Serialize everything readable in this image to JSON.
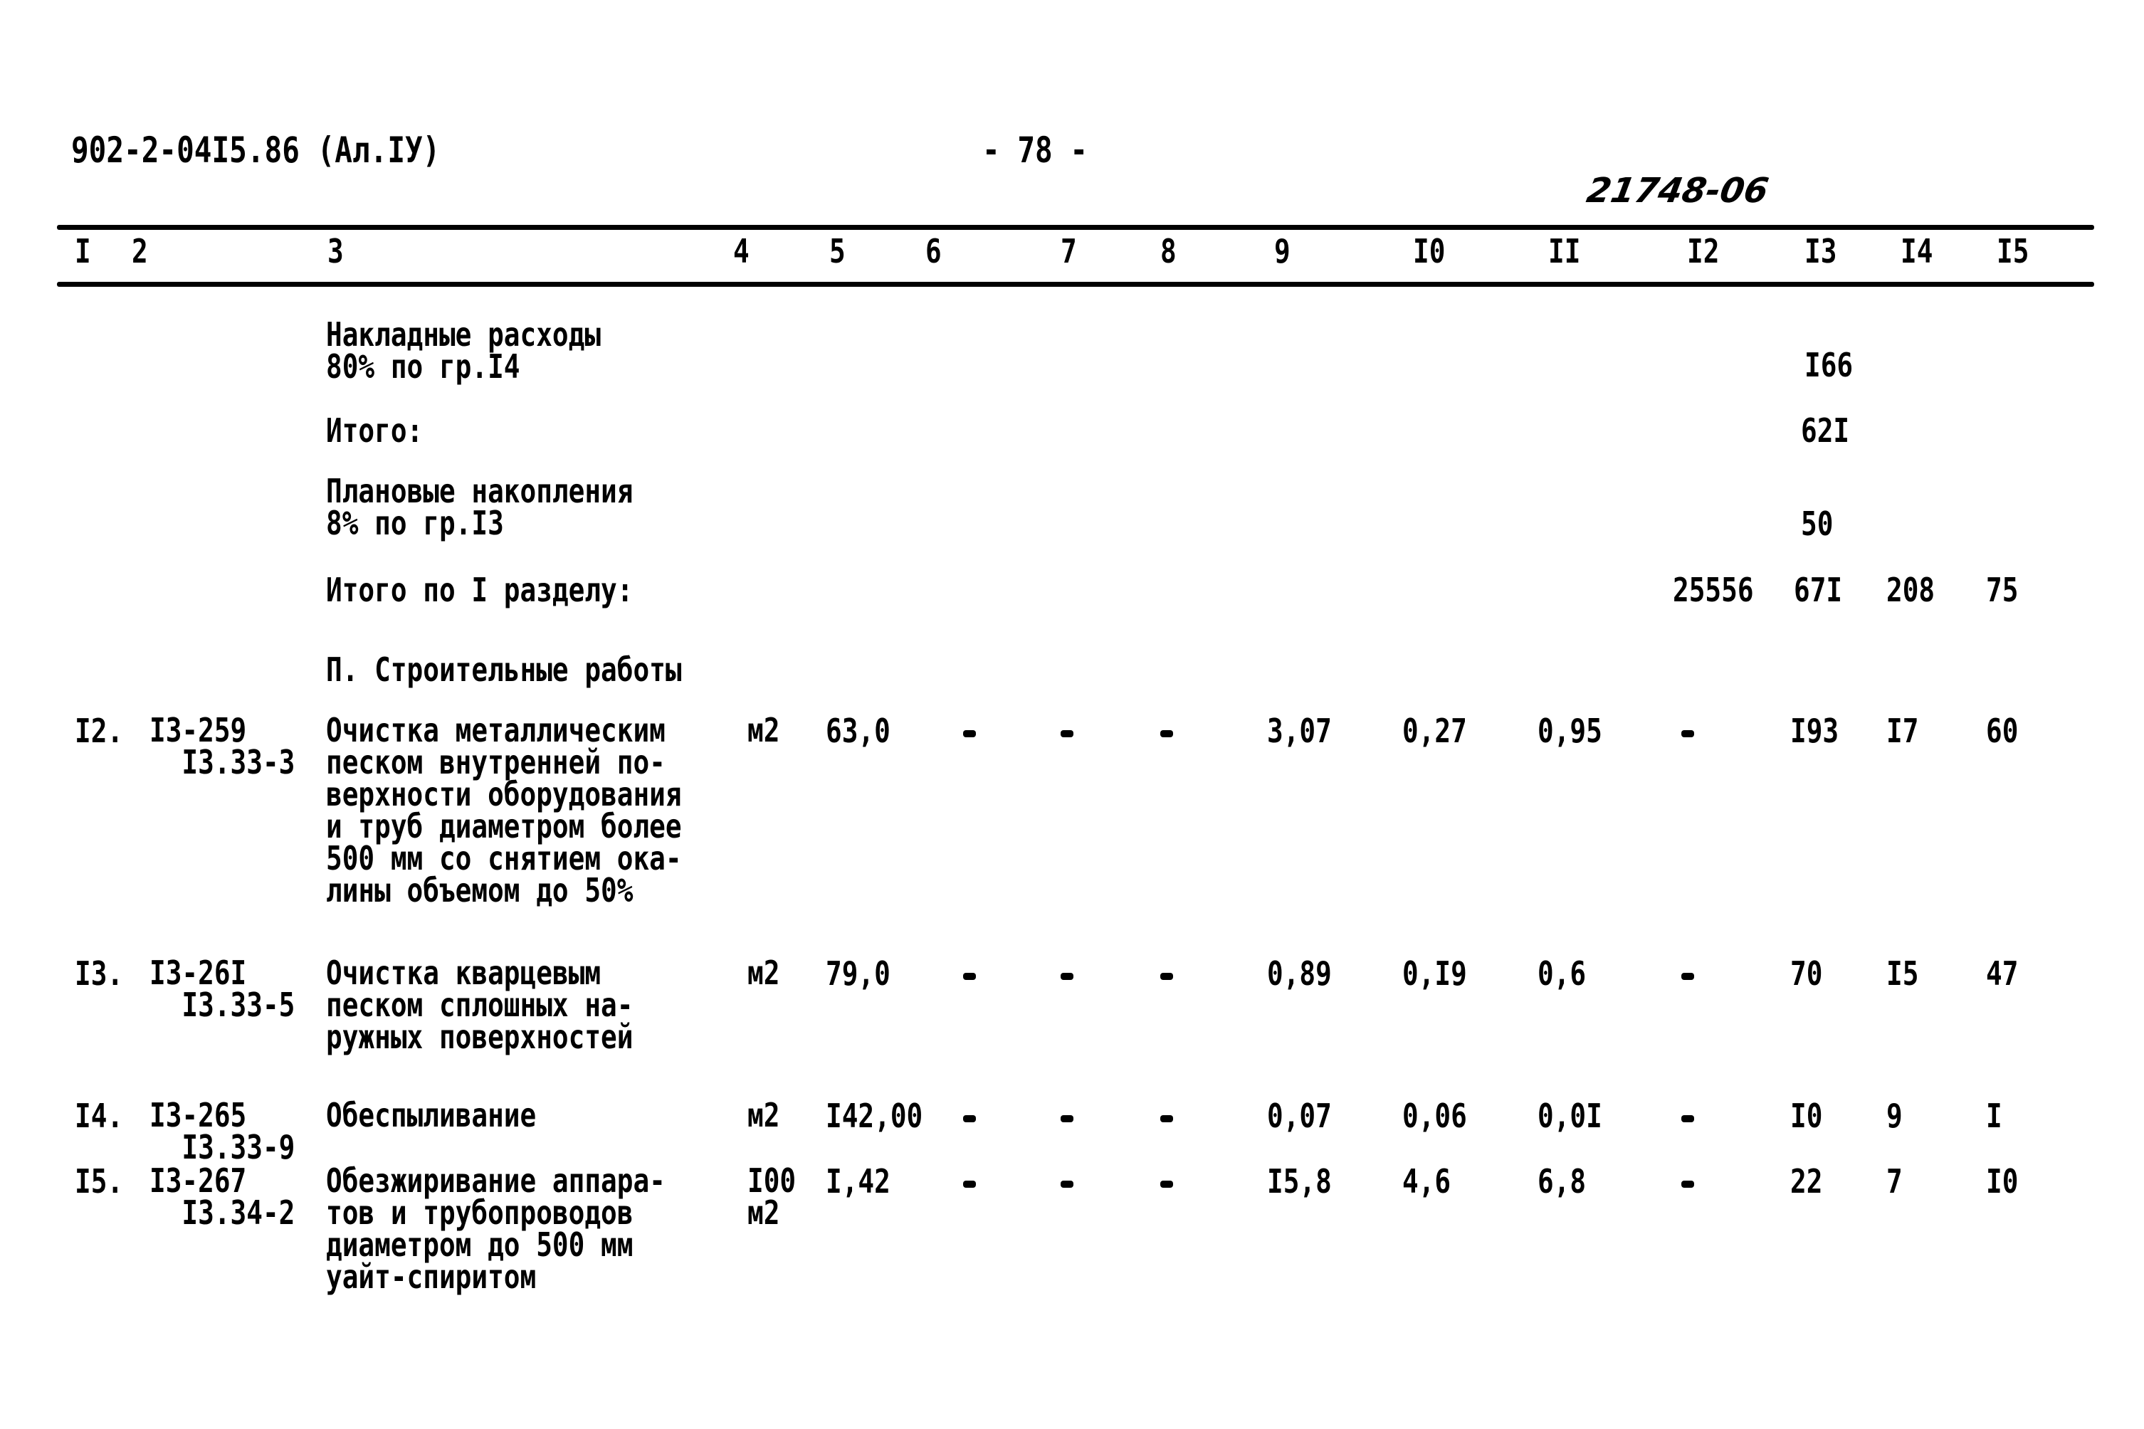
{
  "header": {
    "doc_code": "902-2-04I5.86 (Ал.IУ)",
    "page_number": "- 78 -",
    "stamp": "21748-06"
  },
  "columns": [
    "I",
    "2",
    "3",
    "4",
    "5",
    "6",
    "7",
    "8",
    "9",
    "I0",
    "II",
    "I2",
    "I3",
    "I4",
    "I5"
  ],
  "summary_rows": [
    {
      "label": "Накладные расходы\n80% по гр.I4",
      "c13": "I66"
    },
    {
      "label": "Итого:",
      "c13": "62I"
    },
    {
      "label": "Плановые накопления\n8% по гр.I3",
      "c13": "50"
    },
    {
      "label": "Итого по I разделу:",
      "c12": "25556",
      "c13": "67I",
      "c14": "208",
      "c15": "75"
    }
  ],
  "section_title": "П. Строительные работы",
  "items": [
    {
      "num": "I2.",
      "code": "I3-259\n  I3.33-3",
      "description": "Очистка металлическим\nпеском внутренней по-\nверхности оборудования\nи труб диаметром более\n500 мм со снятием ока-\nлины объемом до 50%",
      "unit": "м2",
      "qty": "63,0",
      "c6": "-",
      "c7": "-",
      "c8": "-",
      "c9": "3,07",
      "c10": "0,27",
      "c11": "0,95",
      "c12": "-",
      "c13": "I93",
      "c14": "I7",
      "c15": "60"
    },
    {
      "num": "I3.",
      "code": "I3-26I\n  I3.33-5",
      "description": "Очистка кварцевым\nпеском сплошных на-\nружных поверхностей",
      "unit": "м2",
      "qty": "79,0",
      "c6": "-",
      "c7": "-",
      "c8": "-",
      "c9": "0,89",
      "c10": "0,I9",
      "c11": "0,6",
      "c12": "-",
      "c13": "70",
      "c14": "I5",
      "c15": "47"
    },
    {
      "num": "I4.",
      "code": "I3-265\n  I3.33-9",
      "description": "Обеспыливание",
      "unit": "м2",
      "qty": "I42,00",
      "c6": "-",
      "c7": "-",
      "c8": "-",
      "c9": "0,07",
      "c10": "0,06",
      "c11": "0,0I",
      "c12": "-",
      "c13": "I0",
      "c14": "9",
      "c15": "I"
    },
    {
      "num": "I5.",
      "code": "I3-267\n  I3.34-2",
      "description": "Обезжиривание аппара-\nтов и трубопроводов\nдиаметром до 500 мм\nуайт-спиритом",
      "unit": "I00\nм2",
      "qty": "I,42",
      "c6": "-",
      "c7": "-",
      "c8": "-",
      "c9": "I5,8",
      "c10": "4,6",
      "c11": "6,8",
      "c12": "-",
      "c13": "22",
      "c14": "7",
      "c15": "I0"
    }
  ]
}
